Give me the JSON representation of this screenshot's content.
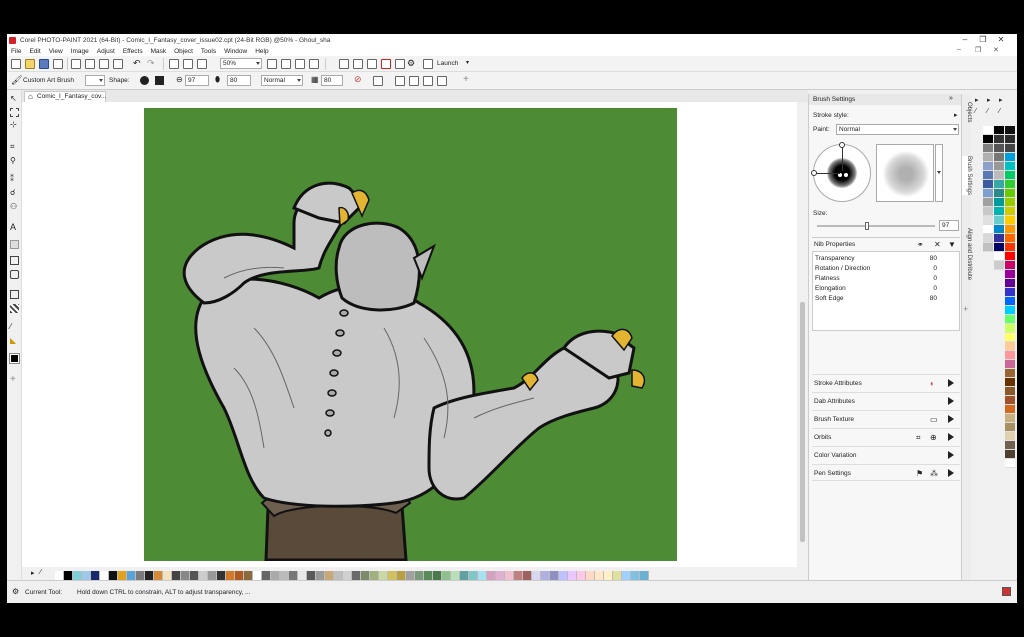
{
  "window": {
    "title": "Corel PHOTO-PAINT 2021 (64-Bit) - Comic_I_Fantasy_cover_issue02.cpt (24-Bit RGB) @50% - Ghoul_sha",
    "controls": [
      "–",
      "❐",
      "✕"
    ]
  },
  "menu": {
    "items": [
      "File",
      "Edit",
      "View",
      "Image",
      "Adjust",
      "Effects",
      "Mask",
      "Object",
      "Tools",
      "Window",
      "Help"
    ],
    "right_controls": [
      "–",
      "❐",
      "✕"
    ]
  },
  "toolbar": {
    "zoom": "50%",
    "launch_label": "Launch"
  },
  "property_bar": {
    "brush_name": "Custom Art Brush",
    "shape_label": "Shape:",
    "size_value": "97",
    "transparency_value": "80",
    "merge_mode": "Normal",
    "soft_edge_value": "80"
  },
  "document_tab": {
    "label": "Comic_I_Fantasy_cov..."
  },
  "brush_settings": {
    "title": "Brush Settings",
    "stroke_style_label": "Stroke style:",
    "paint_label": "Paint:",
    "paint_value": "Normal",
    "size_label": "Size:",
    "size_value": "97",
    "size_fraction": 0.42,
    "nib_properties_label": "Nib Properties",
    "nib_properties": [
      {
        "name": "Transparency",
        "value": "80"
      },
      {
        "name": "Rotation / Direction",
        "value": "0"
      },
      {
        "name": "Flatness",
        "value": "0"
      },
      {
        "name": "Elongation",
        "value": "0"
      },
      {
        "name": "Soft Edge",
        "value": "80"
      }
    ],
    "sections": [
      {
        "label": "Stroke Attributes"
      },
      {
        "label": "Dab Attributes"
      },
      {
        "label": "Brush Texture"
      },
      {
        "label": "Orbits"
      },
      {
        "label": "Color Variation"
      },
      {
        "label": "Pen Settings"
      }
    ]
  },
  "docker_tabs": [
    "Objects",
    "Brush Settings",
    "Align and Distribute"
  ],
  "status": {
    "tool_label": "Current Tool:",
    "hint": "Hold down CTRL to constrain, ALT to adjust transparency, ..."
  },
  "colors": {
    "canvas_green": "#4d8b35",
    "skin": "#c9c9c9",
    "claw": "#e2b431",
    "base": "#5a4a3a"
  },
  "palette_bottom": [
    "#ffffff",
    "#000000",
    "#7ecfd8",
    "#9ec7e8",
    "#1a2b6d",
    "#ffffff",
    "#111111",
    "#e0a020",
    "#5aa2d8",
    "#7a7a7a",
    "#222222",
    "#d38b3a",
    "#f4e1c0",
    "#444444",
    "#888888",
    "#555555",
    "#cccccc",
    "#999999",
    "#333333",
    "#d07a2a",
    "#b05a20",
    "#8a6a3a",
    "#ffffff",
    "#666666",
    "#aaaaaa",
    "#bbbbbb",
    "#777777",
    "#e8e8e8",
    "#5a5a5a",
    "#9a9a9a",
    "#c8a878",
    "#bfbfbf",
    "#d0d0d0",
    "#6a6a6a",
    "#7a8a6a",
    "#a0b080",
    "#c8d8a0",
    "#d0c060",
    "#b8a040",
    "#a0a0a0",
    "#7a9a7a",
    "#5a8a5a",
    "#4a7a4a",
    "#90c090",
    "#b8e0b8",
    "#60a0a0",
    "#80c8c8",
    "#a8e0f0",
    "#d8a0c0",
    "#e0b0d0",
    "#f0c0d0",
    "#c08080",
    "#a06060",
    "#d8d8f0",
    "#b0b0e0",
    "#9090c0",
    "#c0c0ff",
    "#e8c8ff",
    "#ffc8e8",
    "#ffd8c8",
    "#ffe8c8",
    "#fff0c8",
    "#e0e0a0",
    "#a0d0ff",
    "#80c0e0",
    "#6ab0d0"
  ],
  "swatch_columns": [
    [
      "#ffffff",
      "#000000",
      "#7f7f7f",
      "#b0b0b0",
      "#8ca0c8",
      "#5a78b4",
      "#3c5aa0",
      "#7da0d0",
      "#a0a0a0",
      "#c8c8c8",
      "#e0e0e0",
      "#ffffff",
      "#d8d8d8",
      "#c0c0c0"
    ],
    [
      "#000000",
      "#333333",
      "#555555",
      "#777777",
      "#999999",
      "#bbbbbb",
      "#3aa7a7",
      "#2a8a8a",
      "#009999",
      "#00b3b3",
      "#66cccc",
      "#0088cc",
      "#333399",
      "#000066",
      "#ffffff",
      "#cccccc"
    ],
    [
      "#111111",
      "#2b2b2b",
      "#444444",
      "#00a0e0",
      "#00c0c0",
      "#00cc66",
      "#33cc33",
      "#66cc00",
      "#99cc00",
      "#cccc00",
      "#ffcc00",
      "#ff9900",
      "#ff6600",
      "#ff3300",
      "#ff0000",
      "#cc0066",
      "#990099",
      "#660099",
      "#3333cc",
      "#0066ff",
      "#00ccff",
      "#66ff66",
      "#ccff66",
      "#ffff66",
      "#ffcc99",
      "#ff9999",
      "#cc6699",
      "#996633",
      "#663300",
      "#8b5a2b",
      "#a0522d",
      "#d2691e",
      "#c8b080",
      "#a89060",
      "#e0d0b0",
      "#706050",
      "#504030",
      "#ffffff"
    ]
  ]
}
